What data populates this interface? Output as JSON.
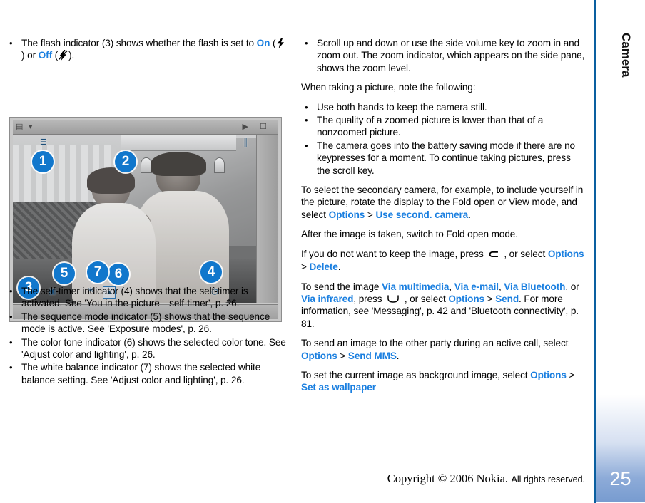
{
  "rail": {
    "chapter_title": "Camera",
    "page_number": "25",
    "accent_color": "#0a5fa0"
  },
  "footer": {
    "copyright": "Copyright © 2006 Nokia.",
    "rights": "All rights reserved."
  },
  "left_column": {
    "flash_bullet": {
      "text_before": "The flash indicator (3) shows whether the flash is set to ",
      "on_label": "On",
      "mid": " (",
      "on_icon": "flash-on-icon",
      "between": ") or ",
      "off_label": "Off",
      "off_icon": "flash-off-icon",
      "text_after": ")."
    },
    "bullets_after_figure": [
      {
        "text": "The self-timer indicator (4) shows that the self-timer is activated. See 'You in the picture—self-timer', p. 26."
      },
      {
        "text": "The sequence mode indicator (5) shows that the sequence mode is active. See 'Exposure modes', p. 26."
      },
      {
        "text": "The color tone indicator (6) shows the selected color tone. See 'Adjust color and lighting', p. 26."
      },
      {
        "text": "The white balance indicator (7) shows the selected white balance setting. See 'Adjust color and lighting', p. 26."
      }
    ]
  },
  "figure": {
    "caption_alt": "Camera viewfinder screenshot with numbered indicator callouts",
    "callouts": [
      "1",
      "2",
      "3",
      "4",
      "5",
      "6",
      "7"
    ],
    "callout_color": "#1177cc"
  },
  "right_column": {
    "zoom_bullet": "Scroll up and down or use the side volume key to zoom in and zoom out. The zoom indicator, which appears on the side pane, shows the zoom level.",
    "note_intro": "When taking a picture, note the following:",
    "note_bullets": [
      "Use both hands to keep the camera still.",
      "The quality of a zoomed picture is lower than that of a nonzoomed picture.",
      "The camera goes into the battery saving mode if there are no keypresses for a moment. To continue taking pictures, press the scroll key."
    ],
    "secondary_camera": {
      "a": "To select the secondary camera, for example, to include yourself in the picture, rotate the display to the Fold open or View mode, and select ",
      "options": "Options",
      "sep": " > ",
      "use_second": "Use second. camera",
      "end": "."
    },
    "after_image": "After the image is taken, switch to Fold open mode.",
    "delete_para": {
      "a": "If you do not want to keep the image, press ",
      "key_icon": "clear-key-icon",
      "b": " , or select ",
      "options": "Options",
      "sep": " > ",
      "delete": "Delete",
      "end": "."
    },
    "send_para": {
      "a": "To send the image ",
      "via_multimedia": "Via multimedia",
      "c1": ", ",
      "via_email": "Via e-mail",
      "c2": ", ",
      "via_bluetooth": "Via Bluetooth",
      "c3": ", or ",
      "via_infrared": "Via infrared",
      "b": ", press ",
      "key_icon": "scroll-key-icon",
      "d": " , or select ",
      "options": "Options",
      "sep": " > ",
      "send": "Send",
      "e": ". For more information, see 'Messaging', p. 42 and 'Bluetooth connectivity', p. 81."
    },
    "mms_para": {
      "a": "To send an image to the other party during an active call, select ",
      "options": "Options",
      "sep": " > ",
      "send_mms": "Send MMS",
      "end": "."
    },
    "wallpaper_para": {
      "a": "To set the current image as background image, select ",
      "options": "Options",
      "sep": " > ",
      "set_as_wallpaper": "Set as wallpaper"
    }
  }
}
